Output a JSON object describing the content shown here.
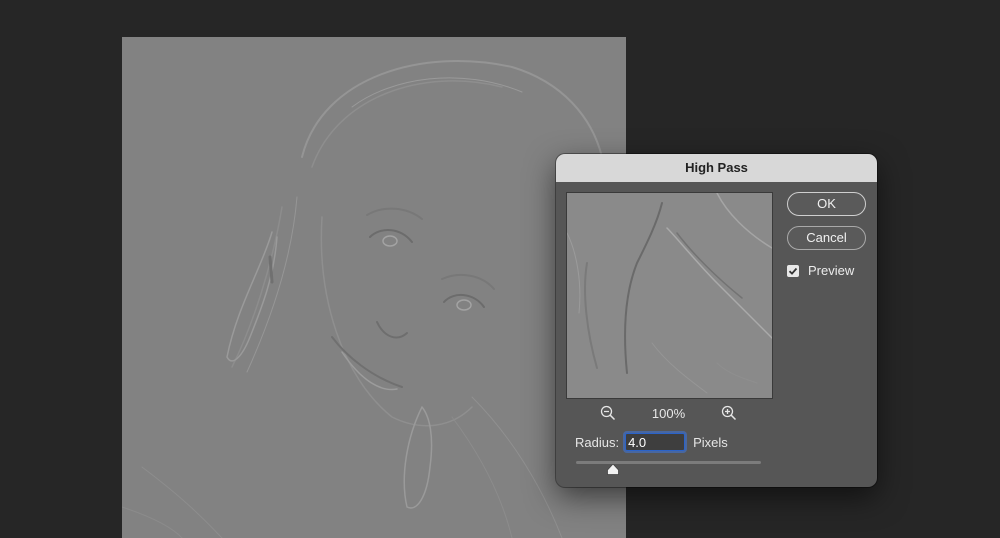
{
  "dialog": {
    "title": "High Pass",
    "ok_label": "OK",
    "cancel_label": "Cancel",
    "preview_label": "Preview",
    "preview_checked": true,
    "zoom_level": "100%",
    "radius_label": "Radius:",
    "radius_value": "4.0",
    "radius_unit": "Pixels",
    "radius_slider_fraction": 0.2,
    "zoom_out_icon": "zoom-out-icon",
    "zoom_in_icon": "zoom-in-icon"
  },
  "colors": {
    "app_background": "#262626",
    "canvas_gray": "#828282",
    "dialog_background": "#565656",
    "titlebar": "#d8d8d8",
    "focus_ring": "#2b63c9"
  }
}
